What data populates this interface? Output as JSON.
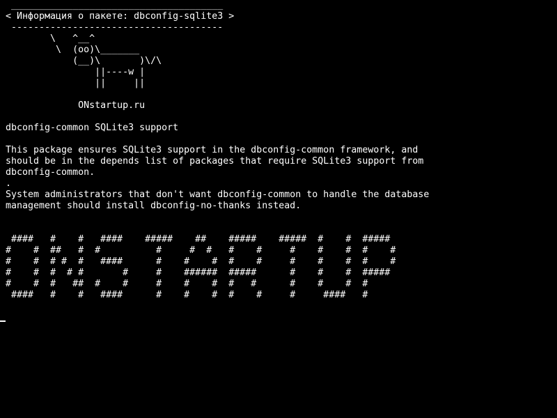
{
  "terminal": {
    "cowsay": {
      "border_top": " ______________________________________",
      "message": "< Информация о пакете: dbconfig-sqlite3 >",
      "border_bottom": " --------------------------------------",
      "cow_1": "        \\   ^__^",
      "cow_2": "         \\  (oo)\\_______",
      "cow_3": "            (__)\\       )\\/\\",
      "cow_4": "                ||----w |",
      "cow_5": "                ||     ||"
    },
    "site_label": "             ONstartup.ru",
    "package_summary": "dbconfig-common SQLite3 support",
    "description": [
      "This package ensures SQLite3 support in the dbconfig-common framework, and",
      "should be in the depends list of packages that require SQLite3 support from",
      "dbconfig-common.",
      ".",
      "System administrators that don't want dbconfig-common to handle the database",
      "management should install dbconfig-no-thanks instead."
    ],
    "banner": [
      " ####   #    #   ####    #####    ##    #####    #####  #    #  #####",
      "#    #  ##   #  #          #     #  #   #    #     #    #    #  #    #",
      "#    #  # #  #   ####      #    #    #  #    #     #    #    #  #    #",
      "#    #  #  # #       #     #    ######  #####      #    #    #  #####",
      "#    #  #   ##  #    #     #    #    #  #   #      #    #    #  #",
      " ####   #    #   ####      #    #    #  #    #     #     ####   #"
    ]
  }
}
